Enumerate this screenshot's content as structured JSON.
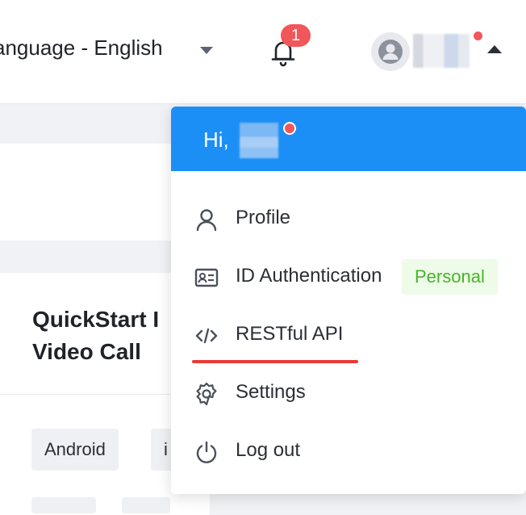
{
  "header": {
    "language_label": "anguage - English",
    "notification_count": "1"
  },
  "background": {
    "card_title": "QuickStart I\nVideo Call",
    "tags": [
      "Android",
      "i"
    ]
  },
  "user_menu": {
    "greeting": "Hi, ",
    "items": [
      {
        "label": "Profile",
        "icon": "user-icon"
      },
      {
        "label": "ID Authentication",
        "icon": "id-card-icon",
        "badge": "Personal"
      },
      {
        "label": "RESTful API",
        "icon": "code-icon"
      },
      {
        "label": "Settings",
        "icon": "gear-icon"
      },
      {
        "label": "Log out",
        "icon": "power-icon"
      }
    ]
  },
  "colors": {
    "menu_header": "#1b8ff5",
    "badge_dot": "#f0565a",
    "personal_badge_text": "#45b52b",
    "highlight_underline": "#eb3b35"
  }
}
